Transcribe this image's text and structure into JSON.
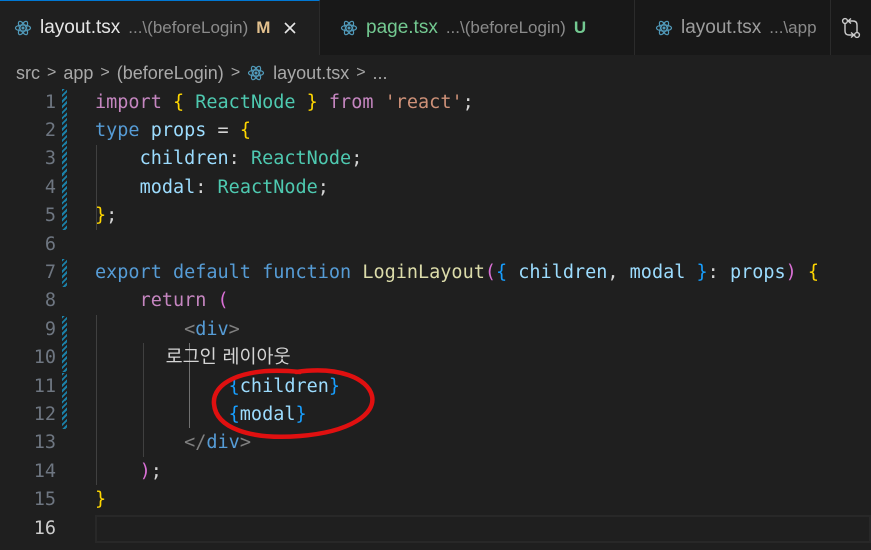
{
  "tabs": [
    {
      "name": "layout.tsx",
      "path": "...\\(beforeLogin)",
      "status": "M",
      "active": true
    },
    {
      "name": "page.tsx",
      "path": "...\\(beforeLogin)",
      "status": "U",
      "active": false
    },
    {
      "name": "layout.tsx",
      "path": "...\\app",
      "status": "",
      "active": false
    }
  ],
  "breadcrumb": [
    "src",
    "app",
    "(beforeLogin)",
    "layout.tsx",
    "..."
  ],
  "editor": {
    "line_numbers": [
      "1",
      "2",
      "3",
      "4",
      "5",
      "6",
      "7",
      "8",
      "9",
      "10",
      "11",
      "12",
      "13",
      "14",
      "15",
      "16"
    ],
    "current_line": "16",
    "code_lines": [
      "import { ReactNode } from 'react';",
      "type props = {",
      "    children: ReactNode;",
      "    modal: ReactNode;",
      "};",
      "",
      "export default function LoginLayout({ children, modal }: props) {",
      "    return (",
      "        <div>",
      "            로그인 레이아웃",
      "            {children}",
      "            {modal}",
      "        </div>",
      "    );",
      "}",
      ""
    ]
  },
  "icons": {
    "tab_file_icon": "react-icon",
    "close": "close-icon",
    "action": "source-control-compare-icon"
  },
  "colors": {
    "accent": "#0078d4",
    "annotation_circle": "#e01010",
    "modified": "#e2c08d",
    "untracked": "#73c991"
  }
}
